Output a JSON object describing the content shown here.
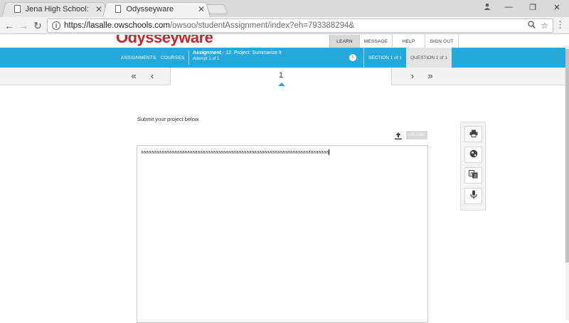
{
  "browser": {
    "tabs": [
      {
        "title": "Jena High School: Home",
        "active": false
      },
      {
        "title": "Odysseyware",
        "active": true
      }
    ],
    "url_host": "https://lasalle.owschools.com",
    "url_path": "/owsoo/studentAssignment/index?eh=793388294&"
  },
  "site": {
    "logo_text": "Odysseyware",
    "top_nav": {
      "learn": "LEARN",
      "message": "MESSAGE",
      "help": "HELP",
      "sign_out": "SIGN OUT"
    }
  },
  "assignment_bar": {
    "assignments": "ASSIGNMENTS",
    "courses": "COURSES",
    "label": "Assignment",
    "name": " - 12. Project: Summarize It",
    "attempt": "Attempt 1 of 1",
    "section": "SECTION 1 of 1",
    "question": "QUESTION 1 of 1"
  },
  "question_nav": {
    "current": "1"
  },
  "content": {
    "instructions": "Submit your project below.",
    "upload_label": "UPLOAD",
    "editor_text": "aaaaaaaaaaaaaaaaaaaaaaaaaaaaaaaaaaaaaaaaaaaaaaaaaaaaaaaaaaaaaaaaaaaaaaaaa"
  },
  "colors": {
    "brand_red": "#c1272d",
    "accent_blue": "#25a9dd"
  }
}
